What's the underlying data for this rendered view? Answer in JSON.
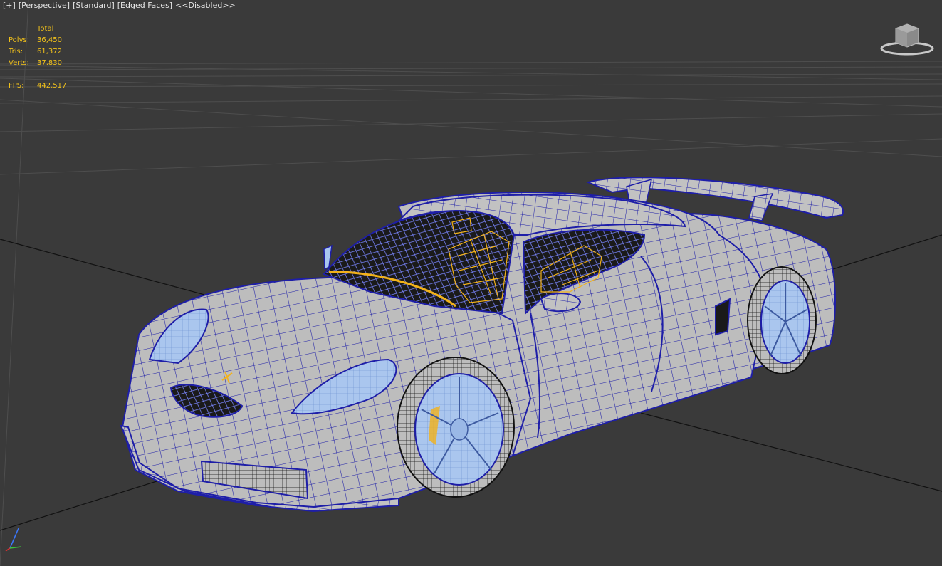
{
  "viewport": {
    "labels": {
      "plus": "[+]",
      "view": "[Perspective]",
      "shading": "[Standard]",
      "edges": "[Edged Faces]",
      "status": "<<Disabled>>"
    },
    "stats": {
      "header": "Total",
      "polys_label": "Polys:",
      "polys_value": "36,450",
      "tris_label": "Tris:",
      "tris_value": "61,372",
      "verts_label": "Verts:",
      "verts_value": "37,830",
      "fps_label": "FPS:",
      "fps_value": "442.517"
    },
    "colors": {
      "background": "#3a3a3a",
      "stats_text": "#f2c21a",
      "wire_blue": "#1e1ea8",
      "body_gray": "#b9b9b9",
      "interior_yellow": "#f2b21a",
      "rim_blue": "#a9c6ef"
    },
    "icons": {
      "viewcube": "viewcube-icon",
      "axis": "axis-tripod-icon"
    }
  }
}
